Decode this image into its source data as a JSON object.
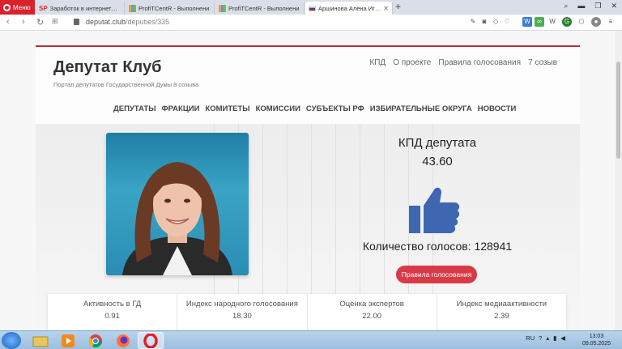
{
  "browser": {
    "menu_label": "Меню",
    "tabs": [
      {
        "label": "Заработок в интернете на",
        "fav": "sp",
        "active": false
      },
      {
        "label": "ProfiTCentR - Выполнени",
        "fav": "chart",
        "active": false
      },
      {
        "label": "ProfiTCentR - Выполнени",
        "fav": "chart",
        "active": false
      },
      {
        "label": "Аршинова Алёна Игорев",
        "fav": "ru-flag",
        "active": true
      }
    ],
    "url_host": "deputat.club",
    "url_path": "/deputies/335"
  },
  "site": {
    "title": "Депутат Клуб",
    "subtitle": "Портал депутатов Государственной Думы 8 созыва",
    "top_links": [
      "КПД",
      "О проекте",
      "Правила голосования",
      "7 созыв"
    ],
    "nav": [
      "ДЕПУТАТЫ",
      "ФРАКЦИИ",
      "КОМИТЕТЫ",
      "КОМИССИИ",
      "СУБЪЕКТЫ РФ",
      "ИЗБИРАТЕЛЬНЫЕ ОКРУГА",
      "НОВОСТИ"
    ]
  },
  "deputy": {
    "kpd_title": "КПД депутата",
    "kpd_value": "43.60",
    "votes_text": "Количество голосов: 128941",
    "rules_button": "Правила голосования",
    "stats": [
      {
        "title": "Активность в ГД",
        "value": "0.91"
      },
      {
        "title": "Индекс народного голосования",
        "value": "18.30"
      },
      {
        "title": "Оценка экспертов",
        "value": "22.00"
      },
      {
        "title": "Индекс медиаактивности",
        "value": "2.39"
      }
    ]
  },
  "taskbar": {
    "lang": "RU",
    "time": "13:03",
    "date": "09.05.2025"
  },
  "colors": {
    "accent": "#d83a48",
    "redline": "#b0313b",
    "thumb": "#3f67b1"
  }
}
